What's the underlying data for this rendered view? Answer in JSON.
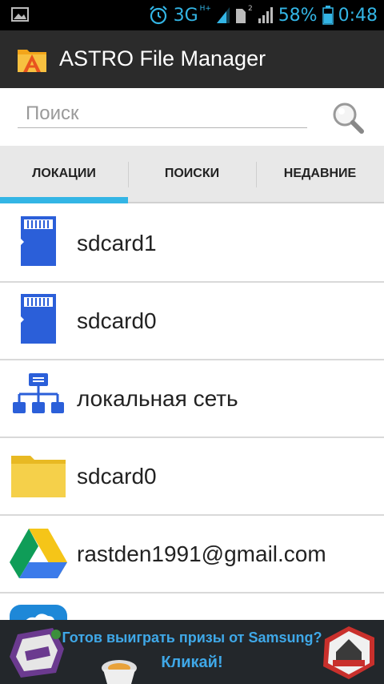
{
  "status_bar": {
    "network": "3G",
    "network_sub": "H+",
    "sim_number": "2",
    "battery_percent": "58%",
    "time": "0:48"
  },
  "app": {
    "title": "ASTRO File Manager"
  },
  "search": {
    "placeholder": "Поиск",
    "value": ""
  },
  "tabs": [
    {
      "label": "ЛОКАЦИИ",
      "active": true
    },
    {
      "label": "ПОИСКИ",
      "active": false
    },
    {
      "label": "НЕДАВНИЕ",
      "active": false
    }
  ],
  "locations": [
    {
      "label": "sdcard1",
      "icon": "sd-card-icon"
    },
    {
      "label": "sdcard0",
      "icon": "sd-card-icon"
    },
    {
      "label": "локальная сеть",
      "icon": "network-icon"
    },
    {
      "label": "sdcard0",
      "icon": "folder-icon"
    },
    {
      "label": "rastden1991@gmail.com",
      "icon": "google-drive-icon"
    }
  ],
  "ad": {
    "line1": "Готов выиграть призы от Samsung?",
    "line2": "Кликай!"
  },
  "colors": {
    "accent": "#33b5e5",
    "actionbar": "#2b2b2b",
    "sd_blue": "#2b5fd9"
  }
}
